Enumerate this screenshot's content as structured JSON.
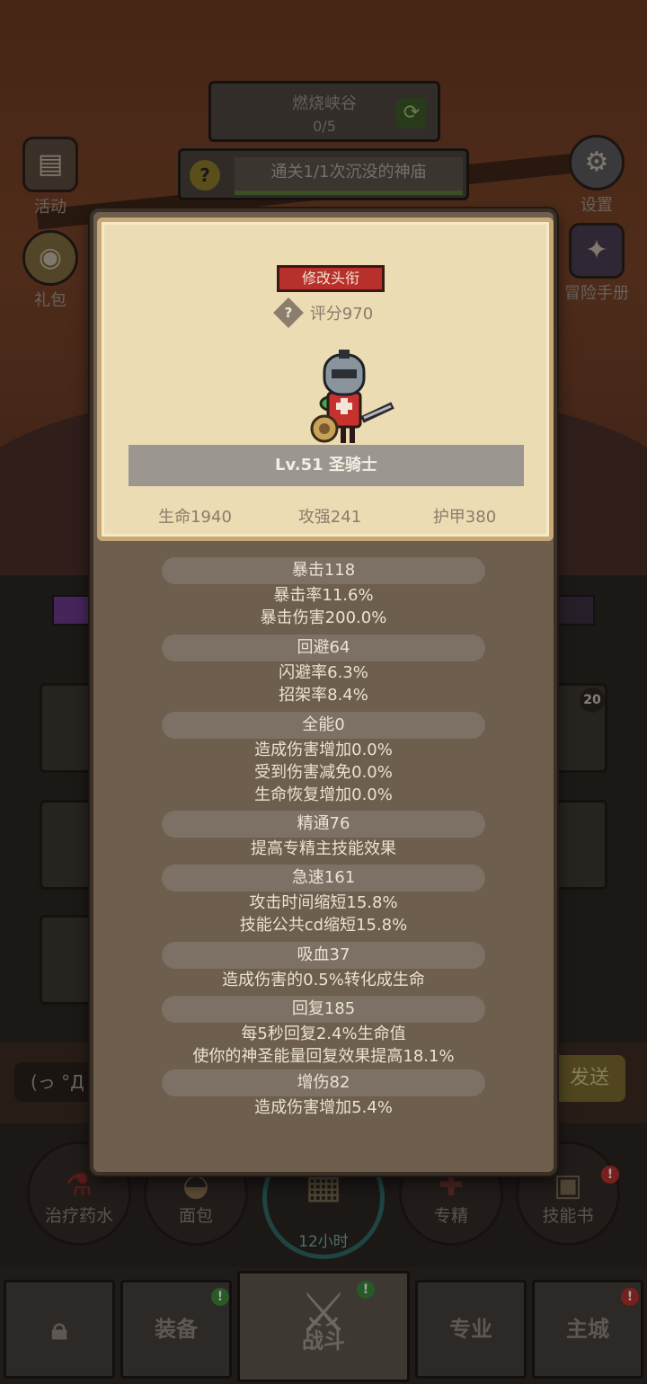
{
  "background": {
    "zone": {
      "name": "燃烧峡谷",
      "progress": "0/5"
    },
    "quest": {
      "text": "通关1/1次沉没的神庙"
    },
    "left_buttons": [
      {
        "label": "活动",
        "icon": "scroll-icon"
      },
      {
        "label": "礼包",
        "icon": "gift-helmet-icon"
      }
    ],
    "right_buttons": [
      {
        "label": "设置",
        "icon": "gear-icon"
      },
      {
        "label": "冒险手册",
        "icon": "book-icon"
      }
    ],
    "chat": {
      "input_text": "(っ °Д",
      "send_label": "发送"
    },
    "slot_badge": "20",
    "consumables": [
      {
        "label": "治疗药水",
        "icon": "potion-icon"
      },
      {
        "label": "面包",
        "icon": "bread-icon"
      },
      {
        "label": "专精",
        "icon": "spec-icon"
      },
      {
        "label": "技能书",
        "icon": "skill-book-icon"
      }
    ],
    "chest_timer": "12小时",
    "nav": [
      {
        "label": "",
        "icon": "lock-icon"
      },
      {
        "label": "装备"
      },
      {
        "label": "战斗"
      },
      {
        "label": "专业"
      },
      {
        "label": "主城"
      }
    ],
    "alert_mark": "!"
  },
  "profile": {
    "change_title_label": "修改头衔",
    "score_icon_text": "?",
    "score": "评分970",
    "level_class": "Lv.51 圣骑士",
    "base_stats": [
      "生命1940",
      "攻强241",
      "护甲380"
    ]
  },
  "stat_groups": [
    {
      "header": "暴击118",
      "lines": [
        "暴击率11.6%",
        "暴击伤害200.0%"
      ]
    },
    {
      "header": "回避64",
      "lines": [
        "闪避率6.3%",
        "招架率8.4%"
      ]
    },
    {
      "header": "全能0",
      "lines": [
        "造成伤害增加0.0%",
        "受到伤害减免0.0%",
        "生命恢复增加0.0%"
      ]
    },
    {
      "header": "精通76",
      "lines": [
        "提高专精主技能效果"
      ]
    },
    {
      "header": "急速161",
      "lines": [
        "攻击时间缩短15.8%",
        "技能公共cd缩短15.8%"
      ]
    },
    {
      "header": "吸血37",
      "lines": [
        "造成伤害的0.5%转化成生命"
      ]
    },
    {
      "header": "回复185",
      "lines": [
        "每5秒回复2.4%生命值",
        "使你的神圣能量回复效果提高18.1%"
      ]
    },
    {
      "header": "增伤82",
      "lines": [
        "造成伤害增加5.4%"
      ]
    }
  ]
}
